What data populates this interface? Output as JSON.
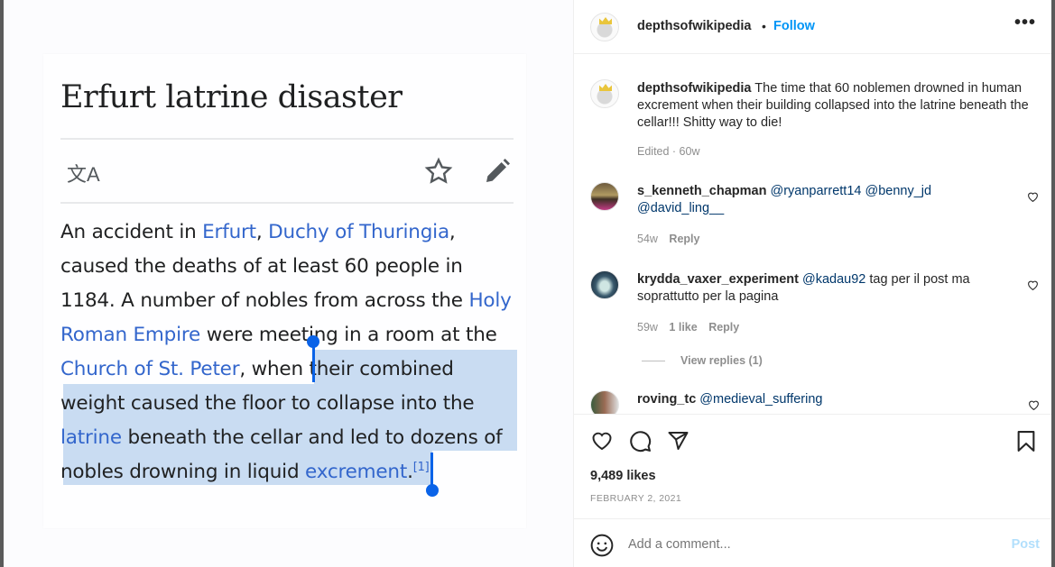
{
  "article": {
    "title": "Erfurt latrine disaster",
    "lang_icon": "文A",
    "p1": "An accident in ",
    "link_erfurt": "Erfurt",
    "comma1": ", ",
    "link_duchy": "Duchy of Thuringia",
    "p2": ", caused the deaths of at least 60 people in 1184. A number of nobles from across the ",
    "link_hre": "Holy Roman Empire",
    "p3": " were meeting in a room at the ",
    "link_church": "Church of St. Peter",
    "p4": ", when ",
    "p5_selected": "their combined weight caused the floor to collapse into the ",
    "link_latrine": "latrine",
    "p6_selected": " beneath the cellar and led to dozens of nobles drowning in liquid ",
    "link_excrement": "excrement",
    "period": ".",
    "citation": "[1]"
  },
  "post": {
    "author": "depthsofwikipedia",
    "separator": "•",
    "follow_label": "Follow",
    "more_label": "•••",
    "caption": "The time that 60 noblemen drowned in human excrement when their building collapsed into the latrine beneath the cellar!!! Shitty way to die!",
    "caption_meta": "Edited · 60w",
    "likes": "9,489 likes",
    "date": "FEBRUARY 2, 2021"
  },
  "comments": [
    {
      "user": "s_kenneth_chapman",
      "mentions": "@ryanparrett14 @benny_jd @david_ling__",
      "text": "",
      "age": "54w",
      "likes": "",
      "reply": "Reply"
    },
    {
      "user": "krydda_vaxer_experiment",
      "mentions": "@kadau92",
      "text": " tag per il post ma soprattutto per la pagina",
      "age": "59w",
      "likes": "1 like",
      "reply": "Reply",
      "view_replies": "View replies (1)"
    },
    {
      "user": "roving_tc",
      "mentions": "@medieval_suffering",
      "text": ""
    }
  ],
  "composer": {
    "placeholder": "Add a comment...",
    "post_label": "Post"
  }
}
